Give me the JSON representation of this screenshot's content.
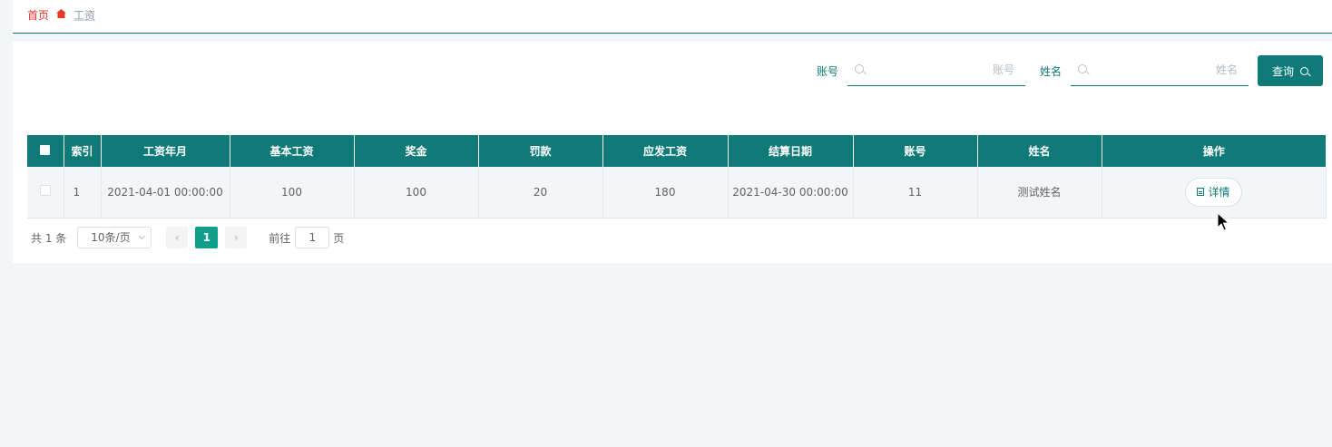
{
  "breadcrumb": {
    "home": "首页",
    "separator_icon": "home-icon",
    "current": "工资"
  },
  "search": {
    "account_label": "账号",
    "account_placeholder": "账号",
    "account_value": "",
    "name_label": "姓名",
    "name_placeholder": "姓名",
    "name_value": "",
    "query_label": "查询"
  },
  "table": {
    "columns": [
      "索引",
      "工资年月",
      "基本工资",
      "奖金",
      "罚款",
      "应发工资",
      "结算日期",
      "账号",
      "姓名",
      "操作"
    ],
    "rows": [
      {
        "index": "1",
        "salary_month": "2021-04-01 00:00:00",
        "base_salary": "100",
        "bonus": "100",
        "penalty": "20",
        "gross_pay": "180",
        "settle_date": "2021-04-30 00:00:00",
        "account": "11",
        "name": "测试姓名",
        "action_label": "详情"
      }
    ]
  },
  "pagination": {
    "total_text": "共 1 条",
    "page_size": "10条/页",
    "prev": "‹",
    "next": "›",
    "current_page": "1",
    "goto_prefix": "前往",
    "goto_value": "1",
    "goto_suffix": "页"
  },
  "colors": {
    "primary": "#0f7a78",
    "active_page": "#0f9f8a",
    "breadcrumb_home": "#e8382c"
  }
}
